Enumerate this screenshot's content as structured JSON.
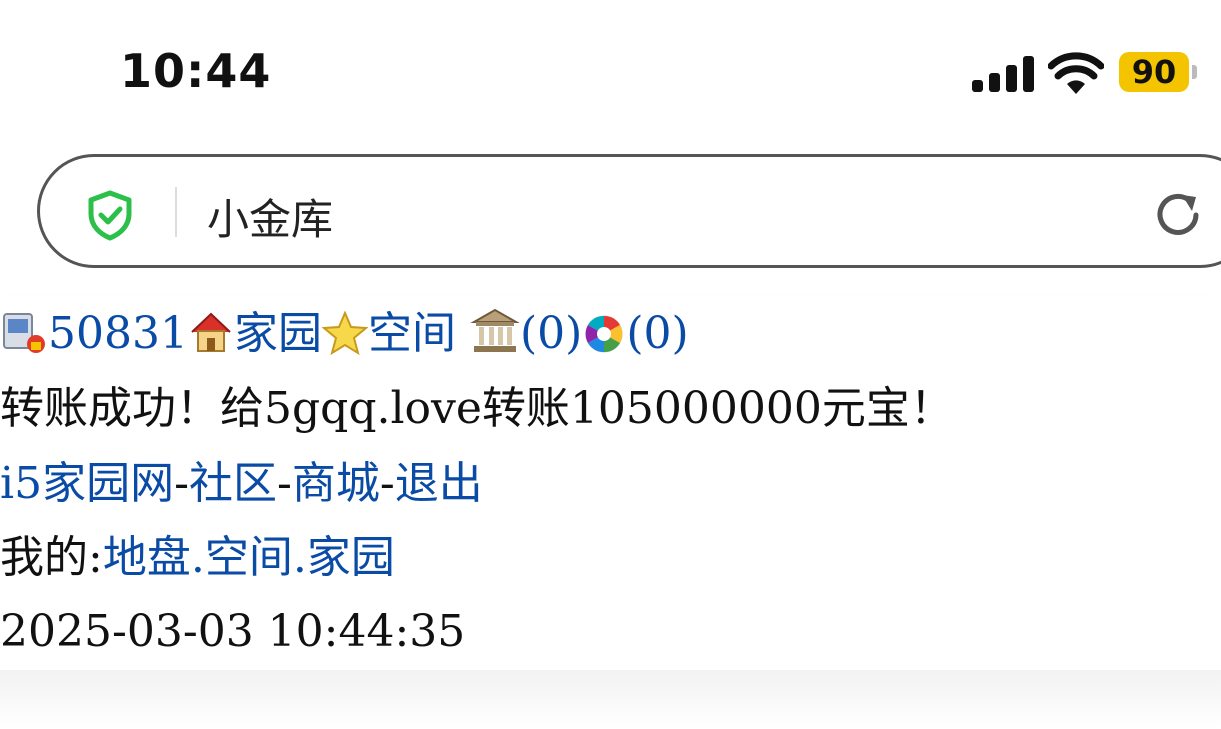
{
  "status_bar": {
    "time": "10:44",
    "battery": "90",
    "icons": [
      "signal-icon",
      "wifi-icon",
      "battery-icon"
    ]
  },
  "address_bar": {
    "title": "小金库",
    "icons": [
      "shield-check-icon",
      "reload-icon"
    ],
    "accent": "#2cbf4a"
  },
  "page": {
    "nav": {
      "user_id": "50831",
      "home_label": "家园",
      "space_label": "空间",
      "bank_count": "(0)",
      "photo_count": "(0)",
      "icons": [
        "user-lock-icon",
        "home-icon",
        "star-icon",
        "bank-icon",
        "photo-icon"
      ]
    },
    "message": {
      "text_before": "转账成功！给",
      "recipient": "5gqq.love",
      "text_middle": "转账",
      "amount": "105000000",
      "text_after": "元宝！"
    },
    "links": {
      "site": "i5家园网",
      "community": "社区",
      "mall": "商城",
      "logout": "退出",
      "separator": "-"
    },
    "mine": {
      "label": "我的:",
      "land": "地盘",
      "space": "空间",
      "home": "家园",
      "dot": "."
    },
    "timestamp": "2025-03-03 10:44:35"
  },
  "colors": {
    "link": "#0a4ba6",
    "text": "#111111",
    "battery": "#f4c400"
  }
}
